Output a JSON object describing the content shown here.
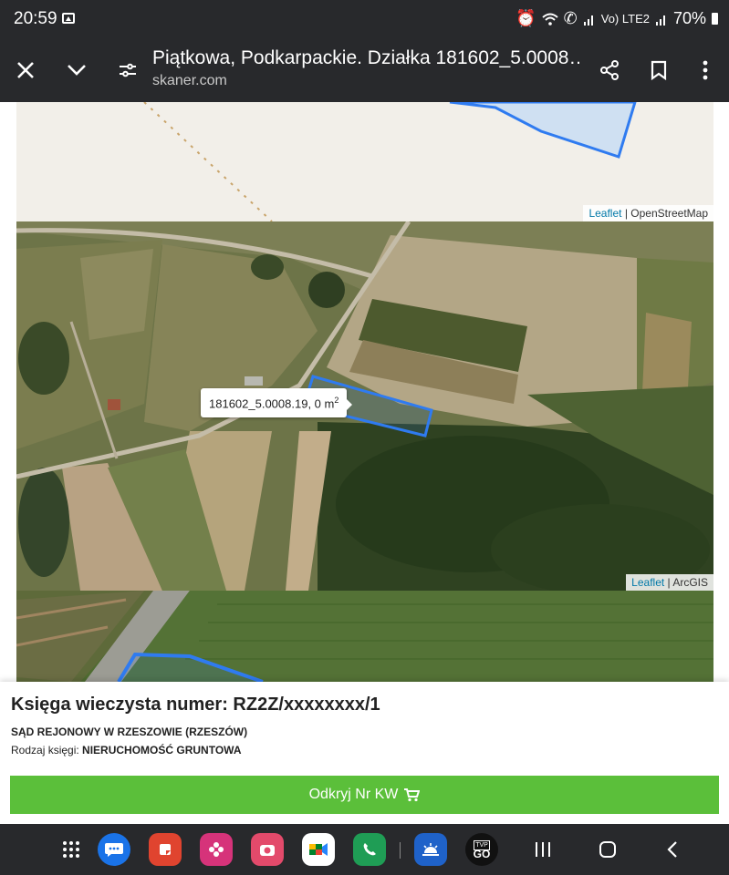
{
  "status_bar": {
    "time": "20:59",
    "right_small": "Vo) LTE2",
    "battery": "70%",
    "icons": [
      "image-icon",
      "alarm-icon",
      "wifi-icon",
      "wifi-call-icon",
      "signal-icon",
      "battery-icon"
    ]
  },
  "toolbar": {
    "title": "Piątkowa, Podkarpackie. Działka 181602_5.0008…",
    "url": "skaner.com",
    "icons": [
      "close-icon",
      "chevron-down-icon",
      "tune-icon",
      "share-icon",
      "bookmark-icon",
      "more-vert-icon"
    ]
  },
  "map": {
    "top_attribution": {
      "leaflet": "Leaflet",
      "sep": " | ",
      "source": "OpenStreetMap"
    },
    "sat_attribution": {
      "leaflet": "Leaflet",
      "sep": " | ",
      "source": "ArcGIS"
    },
    "tooltip": {
      "text": "181602_5.0008.19, 0 m",
      "sup": "2"
    },
    "parcel_outline_color": "#2f7bf0"
  },
  "info": {
    "title": "Księga wieczysta numer: RZ2Z/xxxxxxxx/1",
    "court": "SĄD REJONOWY W RZESZOWIE (RZESZÓW)",
    "book_type_label": "Rodzaj księgi: ",
    "book_type_value": "NIERUCHOMOŚĆ GRUNTOWA",
    "button_label": "Odkryj Nr KW",
    "button_color": "#5bbf3a"
  },
  "nav_bar": {
    "apps": [
      "messages-icon",
      "notes-icon",
      "flower-app-icon",
      "camera-app-icon",
      "meet-icon",
      "phone-icon",
      "weather-icon",
      "tvp-go-icon"
    ],
    "tvp_label": "TVP",
    "go_label": "GO",
    "system": [
      "recents-icon",
      "home-icon",
      "back-icon"
    ]
  }
}
